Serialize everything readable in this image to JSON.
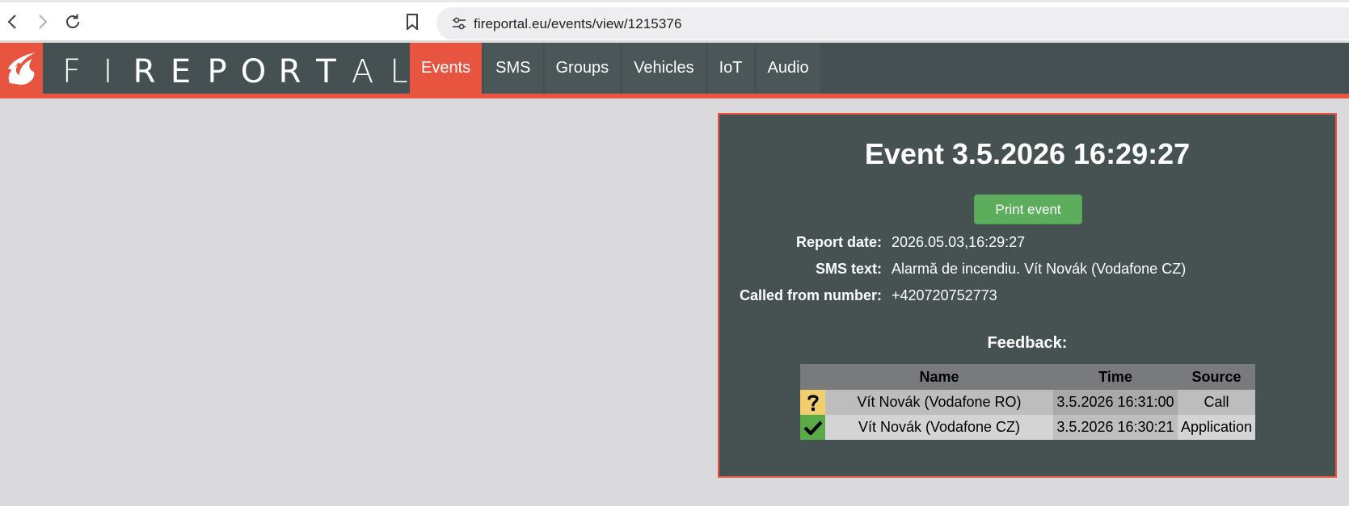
{
  "browser": {
    "url": "fireportal.eu/events/view/1215376"
  },
  "header": {
    "logo_text": [
      "F",
      "I",
      "R",
      "E",
      "P",
      "O",
      "R",
      "T",
      "A",
      "L"
    ],
    "nav": [
      {
        "label": "Events",
        "active": true
      },
      {
        "label": "SMS",
        "active": false
      },
      {
        "label": "Groups",
        "active": false
      },
      {
        "label": "Vehicles",
        "active": false
      },
      {
        "label": "IoT",
        "active": false
      },
      {
        "label": "Audio",
        "active": false
      }
    ],
    "accent_color": "#e75540",
    "bar_color": "#445051"
  },
  "event": {
    "title": "Event 3.5.2026 16:29:27",
    "print_label": "Print event",
    "details": [
      {
        "label": "Report date:",
        "value": "2026.05.03,16:29:27"
      },
      {
        "label": "SMS text:",
        "value": "Alarmă de incendiu. Vít Novák (Vodafone CZ)"
      },
      {
        "label": "Called from number:",
        "value": "+420720752773"
      }
    ],
    "feedback_title": "Feedback:",
    "feedback_columns": [
      "",
      "Name",
      "Time",
      "Source"
    ],
    "feedback_rows": [
      {
        "status_icon": "question-icon",
        "name": "Vít Novák (Vodafone RO)",
        "time": "3.5.2026 16:31:00",
        "source": "Call"
      },
      {
        "status_icon": "check-icon",
        "name": "Vít Novák (Vodafone CZ)",
        "time": "3.5.2026 16:30:21",
        "source": "Application"
      }
    ]
  }
}
